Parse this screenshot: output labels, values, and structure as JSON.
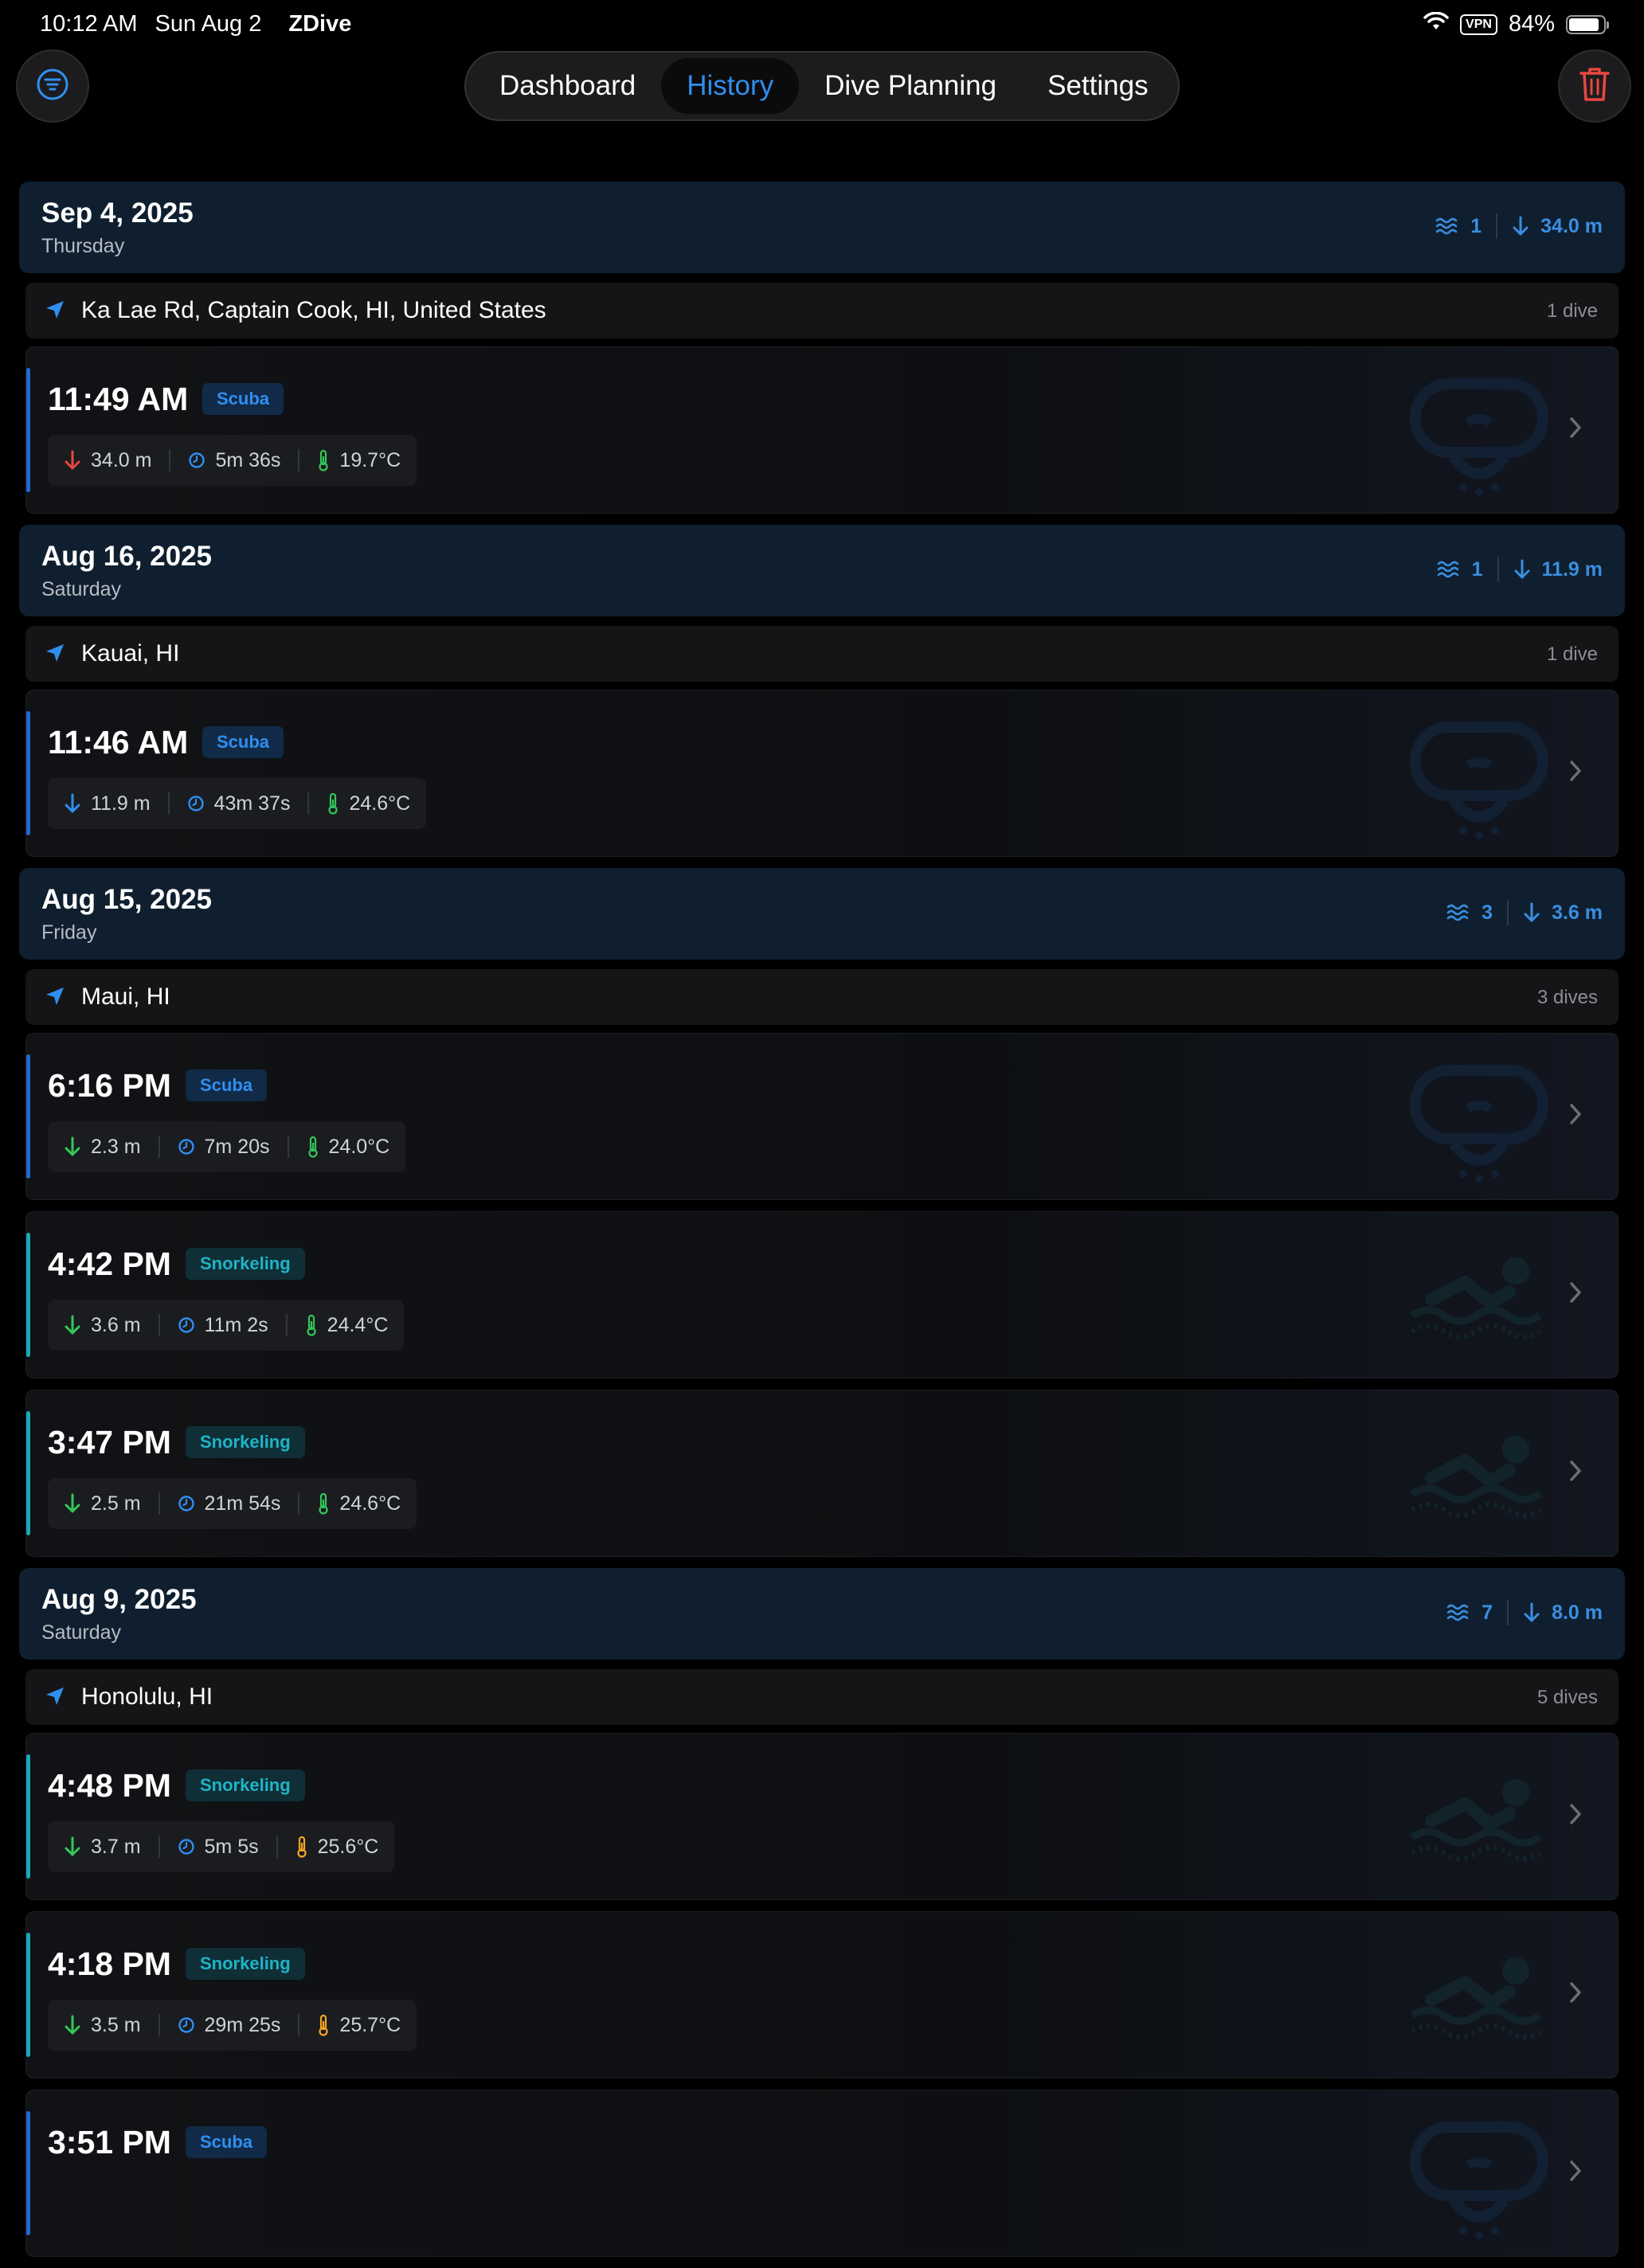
{
  "status_bar": {
    "time": "10:12 AM",
    "date": "Sun Aug 2",
    "app": "ZDive",
    "vpn": "VPN",
    "battery": "84%"
  },
  "nav": {
    "tabs": [
      "Dashboard",
      "History",
      "Dive Planning",
      "Settings"
    ],
    "active_tab": "History"
  },
  "colors": {
    "accent": "#2f8ff0",
    "snorkel": "#1eb4c6",
    "depth_deep": "#e8473f",
    "depth_shallow": "#34c759",
    "temp_cool": "#34c759",
    "temp_warm": "#f5a623",
    "trash": "#e8473f"
  },
  "days": [
    {
      "date": "Sep 4, 2025",
      "weekday": "Thursday",
      "dive_count": "1",
      "max_depth": "34.0 m",
      "location": "Ka Lae Rd, Captain Cook, HI, United States",
      "location_count": "1 dive",
      "dives": [
        {
          "time": "11:49 AM",
          "type": "Scuba",
          "depth": "34.0 m",
          "duration": "5m 36s",
          "temp": "19.7°C"
        }
      ]
    },
    {
      "date": "Aug 16, 2025",
      "weekday": "Saturday",
      "dive_count": "1",
      "max_depth": "11.9 m",
      "location": "Kauai, HI",
      "location_count": "1 dive",
      "dives": [
        {
          "time": "11:46 AM",
          "type": "Scuba",
          "depth": "11.9 m",
          "duration": "43m 37s",
          "temp": "24.6°C"
        }
      ]
    },
    {
      "date": "Aug 15, 2025",
      "weekday": "Friday",
      "dive_count": "3",
      "max_depth": "3.6 m",
      "location": "Maui, HI",
      "location_count": "3 dives",
      "dives": [
        {
          "time": "6:16 PM",
          "type": "Scuba",
          "depth": "2.3 m",
          "duration": "7m 20s",
          "temp": "24.0°C"
        },
        {
          "time": "4:42 PM",
          "type": "Snorkeling",
          "depth": "3.6 m",
          "duration": "11m 2s",
          "temp": "24.4°C"
        },
        {
          "time": "3:47 PM",
          "type": "Snorkeling",
          "depth": "2.5 m",
          "duration": "21m 54s",
          "temp": "24.6°C"
        }
      ]
    },
    {
      "date": "Aug 9, 2025",
      "weekday": "Saturday",
      "dive_count": "7",
      "max_depth": "8.0 m",
      "location": "Honolulu, HI",
      "location_count": "5 dives",
      "dives": [
        {
          "time": "4:48 PM",
          "type": "Snorkeling",
          "depth": "3.7 m",
          "duration": "5m 5s",
          "temp": "25.6°C"
        },
        {
          "time": "4:18 PM",
          "type": "Snorkeling",
          "depth": "3.5 m",
          "duration": "29m 25s",
          "temp": "25.7°C"
        },
        {
          "time": "3:51 PM",
          "type": "Scuba",
          "depth": "",
          "duration": "",
          "temp": ""
        }
      ]
    }
  ]
}
